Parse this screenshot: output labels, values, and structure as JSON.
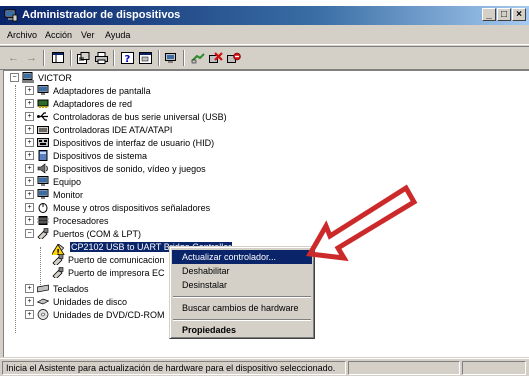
{
  "window": {
    "title": "Administrador de dispositivos",
    "controls": [
      "_",
      "□",
      "×"
    ]
  },
  "menu": [
    "Archivo",
    "Acción",
    "Ver",
    "Ayuda"
  ],
  "toolbar": {
    "icons": [
      "back-icon",
      "forward-icon",
      "console-tree-icon",
      "properties-icon",
      "print-icon",
      "help-icon",
      "view-icon",
      "scan-hardware-icon",
      "update-driver-icon",
      "uninstall-icon",
      "disable-icon"
    ]
  },
  "tree": {
    "root": "VICTOR",
    "items": [
      "Adaptadores de pantalla",
      "Adaptadores de red",
      "Controladoras de bus serie universal (USB)",
      "Controladoras IDE ATA/ATAPI",
      "Dispositivos de interfaz de usuario (HID)",
      "Dispositivos de sistema",
      "Dispositivos de sonido, vídeo y juegos",
      "Equipo",
      "Monitor",
      "Mouse y otros dispositivos señaladores",
      "Procesadores",
      "Puertos (COM & LPT)"
    ],
    "ports_children": [
      "CP2102 USB to UART Bridge Controller",
      "Puerto de comunicacion",
      "Puerto de impresora EC"
    ],
    "after": [
      "Teclados",
      "Unidades de disco",
      "Unidades de DVD/CD-ROM"
    ]
  },
  "context_menu": {
    "items": [
      "Actualizar controlador...",
      "Deshabilitar",
      "Desinstalar",
      "Buscar cambios de hardware",
      "Propiedades"
    ]
  },
  "status": {
    "text": "Inicia el Asistente para actualización de hardware para el dispositivo seleccionado."
  },
  "colors": {
    "arrow": "#cc2a2a",
    "selection": "#0a246a"
  }
}
